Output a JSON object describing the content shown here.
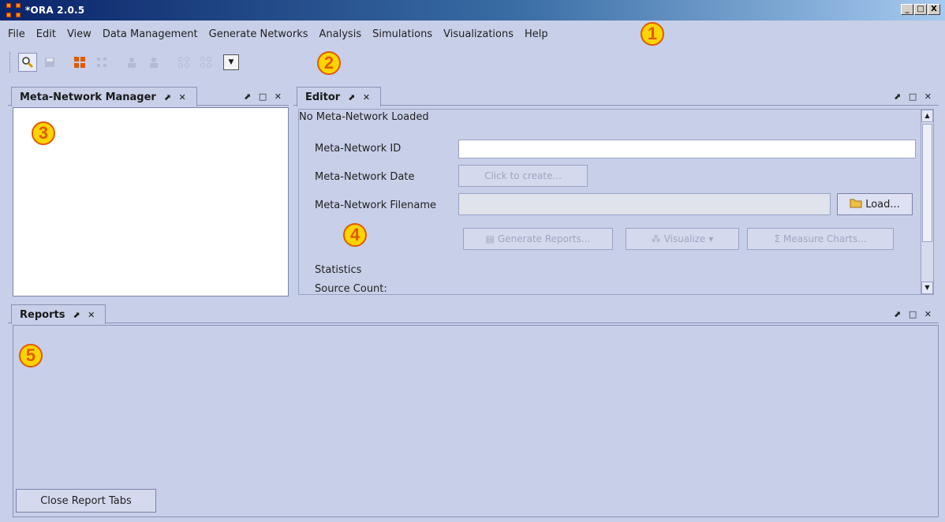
{
  "window": {
    "title": "*ORA 2.0.5",
    "controls": [
      "_",
      "□",
      "X"
    ]
  },
  "menu": [
    "File",
    "Edit",
    "View",
    "Data Management",
    "Generate Networks",
    "Analysis",
    "Simulations",
    "Visualizations",
    "Help"
  ],
  "callouts": [
    "1",
    "2",
    "3",
    "4",
    "5"
  ],
  "toolbar": {
    "buttons": [
      "search-icon",
      "save-icon",
      "network-icon",
      "delete-network-icon",
      "agent-icon",
      "agent-remove-icon",
      "grid-icon",
      "grid-remove-icon"
    ],
    "dropdown_icon": "▼"
  },
  "meta_manager": {
    "tab_label": "Meta-Network Manager",
    "tab_icons": "⬈ ✕",
    "panel_controls": "⬈ □ ✕"
  },
  "editor": {
    "tab_label": "Editor",
    "tab_icons": "⬈ ✕",
    "panel_controls": "⬈ □ ✕",
    "group_title": "No Meta-Network Loaded",
    "id_label": "Meta-Network ID",
    "id_value": "",
    "date_label": "Meta-Network Date",
    "date_button": "Click to create...",
    "filename_label": "Meta-Network Filename",
    "filename_value": "",
    "load_button": "Load...",
    "generate_reports": "Generate Reports...",
    "visualize": "Visualize",
    "measure_charts": "Measure Charts...",
    "statistics_label": "Statistics",
    "source_count_label": "Source Count:"
  },
  "reports": {
    "tab_label": "Reports",
    "tab_icons": "⬈ ✕",
    "panel_controls": "⬈ □ ✕",
    "close_button": "Close Report Tabs"
  },
  "colors": {
    "background": "#c8cfe8",
    "callout_fill": "#ffd400",
    "callout_border": "#e05a00"
  }
}
